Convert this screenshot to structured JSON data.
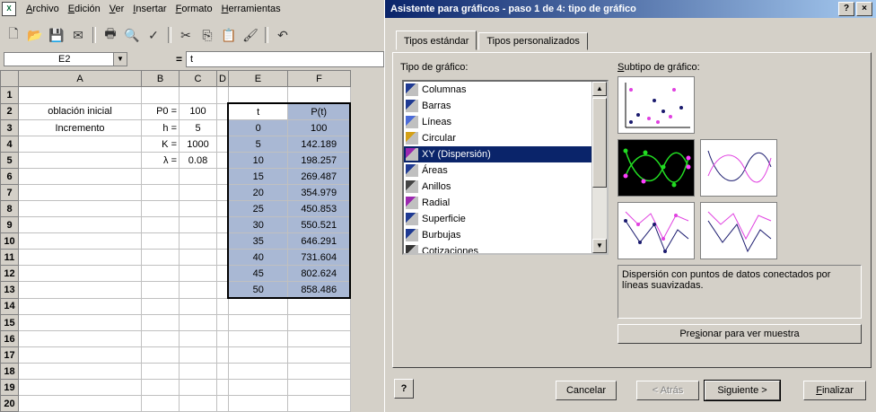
{
  "excel": {
    "menu": [
      {
        "u": "A",
        "rest": "rchivo"
      },
      {
        "u": "E",
        "rest": "dición"
      },
      {
        "u": "V",
        "rest": "er"
      },
      {
        "u": "I",
        "rest": "nsertar"
      },
      {
        "u": "F",
        "rest": "ormato"
      },
      {
        "u": "H",
        "rest": "erramientas"
      }
    ],
    "namebox": "E2",
    "formula_eq": "=",
    "formula": "t",
    "columns": [
      "A",
      "B",
      "C",
      "D",
      "E",
      "F"
    ],
    "rows": [
      {
        "n": "1",
        "A": "",
        "B": "",
        "C": "",
        "E": "",
        "F": ""
      },
      {
        "n": "2",
        "A": "oblación inicial",
        "B": "P0 =",
        "C": "100",
        "E": "t",
        "F": "P(t)"
      },
      {
        "n": "3",
        "A": "Incremento",
        "B": "h =",
        "C": "5",
        "E": "0",
        "F": "100"
      },
      {
        "n": "4",
        "A": "",
        "B": "K =",
        "C": "1000",
        "E": "5",
        "F": "142.189"
      },
      {
        "n": "5",
        "A": "",
        "B": "λ =",
        "C": "0.08",
        "E": "10",
        "F": "198.257"
      },
      {
        "n": "6",
        "A": "",
        "B": "",
        "C": "",
        "E": "15",
        "F": "269.487"
      },
      {
        "n": "7",
        "A": "",
        "B": "",
        "C": "",
        "E": "20",
        "F": "354.979"
      },
      {
        "n": "8",
        "A": "",
        "B": "",
        "C": "",
        "E": "25",
        "F": "450.853"
      },
      {
        "n": "9",
        "A": "",
        "B": "",
        "C": "",
        "E": "30",
        "F": "550.521"
      },
      {
        "n": "10",
        "A": "",
        "B": "",
        "C": "",
        "E": "35",
        "F": "646.291"
      },
      {
        "n": "11",
        "A": "",
        "B": "",
        "C": "",
        "E": "40",
        "F": "731.604"
      },
      {
        "n": "12",
        "A": "",
        "B": "",
        "C": "",
        "E": "45",
        "F": "802.624"
      },
      {
        "n": "13",
        "A": "",
        "B": "",
        "C": "",
        "E": "50",
        "F": "858.486"
      },
      {
        "n": "14",
        "A": "",
        "B": "",
        "C": "",
        "E": "",
        "F": ""
      },
      {
        "n": "15",
        "A": "",
        "B": "",
        "C": "",
        "E": "",
        "F": ""
      },
      {
        "n": "16",
        "A": "",
        "B": "",
        "C": "",
        "E": "",
        "F": ""
      },
      {
        "n": "17",
        "A": "",
        "B": "",
        "C": "",
        "E": "",
        "F": ""
      },
      {
        "n": "18",
        "A": "",
        "B": "",
        "C": "",
        "E": "",
        "F": ""
      },
      {
        "n": "19",
        "A": "",
        "B": "",
        "C": "",
        "E": "",
        "F": ""
      },
      {
        "n": "20",
        "A": "",
        "B": "",
        "C": "",
        "E": "",
        "F": ""
      }
    ]
  },
  "dialog": {
    "title": "Asistente para gráficos - paso 1 de 4: tipo de gráfico",
    "help_btn": "?",
    "close_btn": "×",
    "tabs": [
      "Tipos estándar",
      "Tipos personalizados"
    ],
    "type_label": "Tipo de gráfico:",
    "subtype_label_u": "S",
    "subtype_label_rest": "ubtipo de gráfico:",
    "chart_types": [
      {
        "label": "Columnas",
        "icon": "columns-icon",
        "color": "#1f3a93"
      },
      {
        "label": "Barras",
        "icon": "bars-icon",
        "color": "#1f3a93"
      },
      {
        "label": "Líneas",
        "icon": "lines-icon",
        "color": "#4a6ad8"
      },
      {
        "label": "Circular",
        "icon": "pie-icon",
        "color": "#d4a017"
      },
      {
        "label": "XY (Dispersión)",
        "icon": "scatter-icon",
        "color": "#9c27b0",
        "selected": true
      },
      {
        "label": "Áreas",
        "icon": "area-icon",
        "color": "#1f3a93"
      },
      {
        "label": "Anillos",
        "icon": "doughnut-icon",
        "color": "#444444"
      },
      {
        "label": "Radial",
        "icon": "radar-icon",
        "color": "#9c27b0"
      },
      {
        "label": "Superficie",
        "icon": "surface-icon",
        "color": "#1f3a93"
      },
      {
        "label": "Burbujas",
        "icon": "bubble-icon",
        "color": "#1f3a93"
      },
      {
        "label": "Cotizaciones",
        "icon": "stock-icon",
        "color": "#333333"
      }
    ],
    "description": "Dispersión con puntos de datos conectados por líneas suavizadas.",
    "preview_btn_pre": "Pre",
    "preview_btn_u": "s",
    "preview_btn_post": "ionar para ver muestra",
    "buttons": {
      "cancel": "Cancelar",
      "back": "< Atrás",
      "next": "Siguiente >",
      "finish_u": "F",
      "finish_rest": "inalizar"
    },
    "colors": {
      "accent": "#0a246a",
      "magenta": "#e040e0",
      "navy": "#1a1a6e"
    }
  }
}
